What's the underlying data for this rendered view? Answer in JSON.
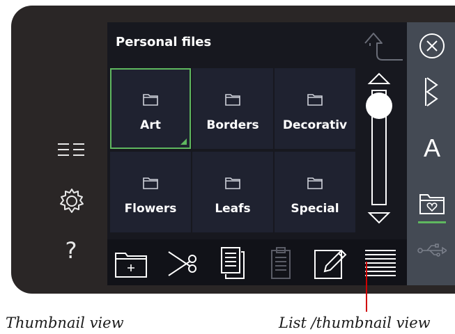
{
  "panel": {
    "title": "Personal files"
  },
  "folders": [
    {
      "label": "Art",
      "selected": true
    },
    {
      "label": "Borders",
      "selected": false
    },
    {
      "label": "Decorativ",
      "selected": false
    },
    {
      "label": "Flowers",
      "selected": false
    },
    {
      "label": "Leafs",
      "selected": false
    },
    {
      "label": "Special",
      "selected": false
    }
  ],
  "left_icons": [
    "list-icon",
    "settings-gear-icon",
    "help-icon"
  ],
  "left_help_text": "?",
  "toolbar": [
    "new-folder-icon",
    "cut-scissors-icon",
    "copy-icon",
    "paste-clipboard-icon",
    "rename-pencil-icon",
    "list-thumbnail-view-icon"
  ],
  "sidebar": [
    "close-icon",
    "stitch-menu-icon",
    "font-menu-icon",
    "file-manager-icon",
    "usb-icon"
  ],
  "sidebar_font_letter": "A",
  "captions": {
    "left": "Thumbnail view",
    "right": "List /thumbnail view"
  },
  "colors": {
    "selected_border": "#5fb85f",
    "callout": "#d00000",
    "screen_bg": "#17181f",
    "sidebar_bg": "#444a54"
  }
}
